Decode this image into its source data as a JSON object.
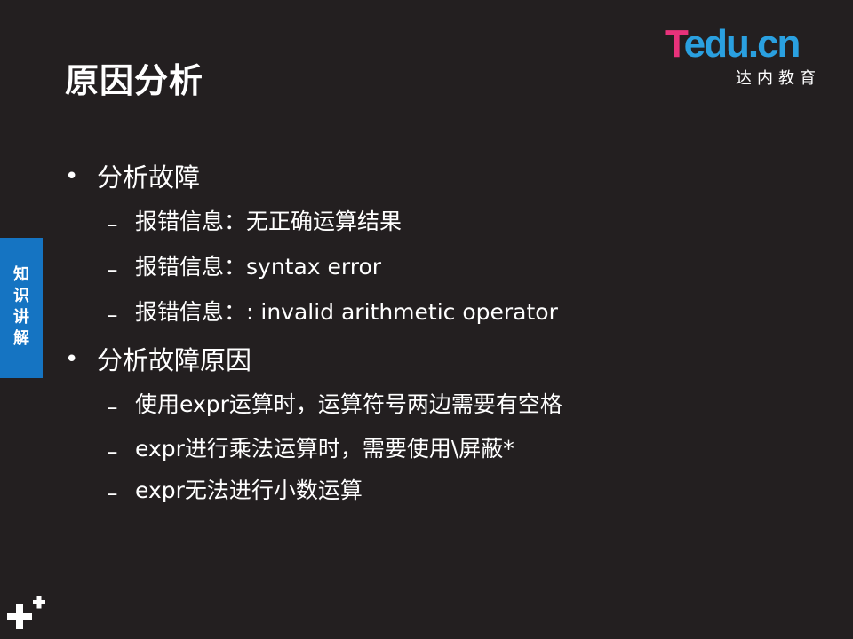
{
  "slide": {
    "title": "原因分析",
    "logo": {
      "brand_t": "T",
      "brand_rest": "edu.cn",
      "subtitle": "达内教育"
    },
    "side_tab": "知识讲解",
    "bullets": [
      {
        "text": "分析故障",
        "items": [
          "报错信息：无正确运算结果",
          "报错信息：syntax error",
          "报错信息：: invalid arithmetic operator"
        ]
      },
      {
        "text": "分析故障原因",
        "items": [
          "使用expr运算时，运算符号两边需要有空格",
          "expr进行乘法运算时，需要使用\\屏蔽*",
          "expr无法进行小数运算"
        ]
      }
    ],
    "bullet_symbol": "•",
    "dash_symbol": "–",
    "colors": {
      "background": "#231f20",
      "logo_pink": "#e8327b",
      "logo_blue": "#2aa0e0",
      "side_tab": "#1574c2"
    },
    "icons": {
      "bottom_left": "plus-icon"
    }
  }
}
